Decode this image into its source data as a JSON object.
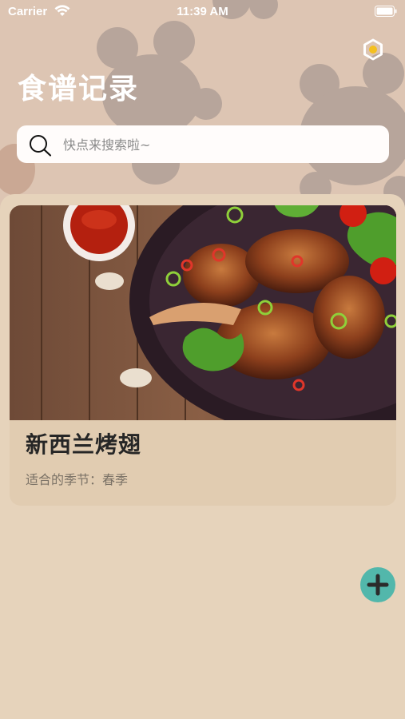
{
  "status_bar": {
    "carrier": "Carrier",
    "time": "11:39 AM"
  },
  "header": {
    "title": "食谱记录"
  },
  "search": {
    "placeholder": "快点来搜索啦~"
  },
  "recipes": [
    {
      "name": "新西兰烤翅",
      "season_label": "适合的季节：",
      "season": "春季"
    }
  ],
  "icons": {
    "settings": "hexagon-settings-icon",
    "search": "search-icon",
    "add": "plus-icon"
  },
  "colors": {
    "accent": "#52b7ab",
    "background": "#e6d3bb",
    "header": "#ddc5b3",
    "settings_icon": "#f4c020"
  }
}
